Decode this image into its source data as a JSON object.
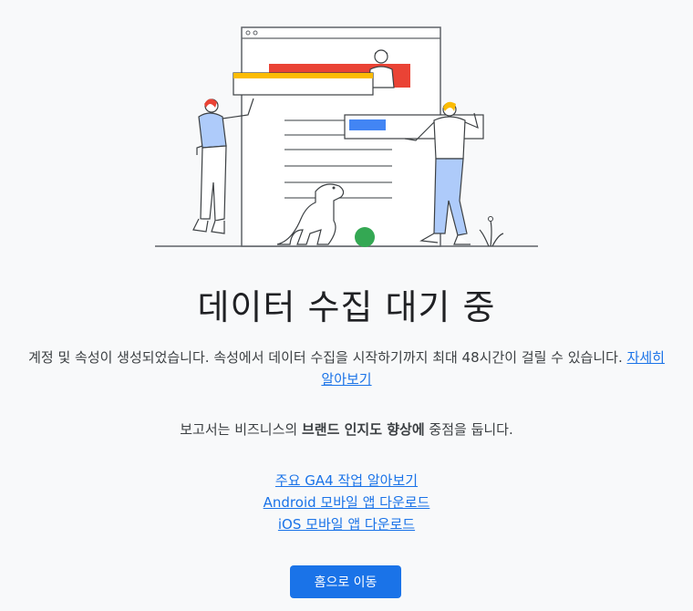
{
  "main": {
    "title": "데이터 수집 대기 중",
    "description_prefix": "계정 및 속성이 생성되었습니다. 속성에서 데이터 수집을 시작하기까지 최대 48시간이 걸릴 수 있습니다.",
    "learn_more_link": "자세히 알아보기",
    "report_prefix": "보고서는 비즈니스의 ",
    "report_bold": "브랜드 인지도 향상에",
    "report_suffix": " 중점을 둡니다.",
    "links": [
      "주요 GA4 작업 알아보기",
      "Android 모바일 앱 다운로드",
      "iOS 모바일 앱 다운로드"
    ],
    "home_button": "홈으로 이동"
  },
  "colors": {
    "accent": "#1a73e8",
    "illustration_red": "#ea4335",
    "illustration_yellow": "#fbbc04",
    "illustration_green": "#34a853",
    "illustration_blue": "#4285f4"
  },
  "illustration": {
    "icons": [
      "people-with-document-illustration",
      "dog-icon",
      "plant-icon"
    ]
  }
}
